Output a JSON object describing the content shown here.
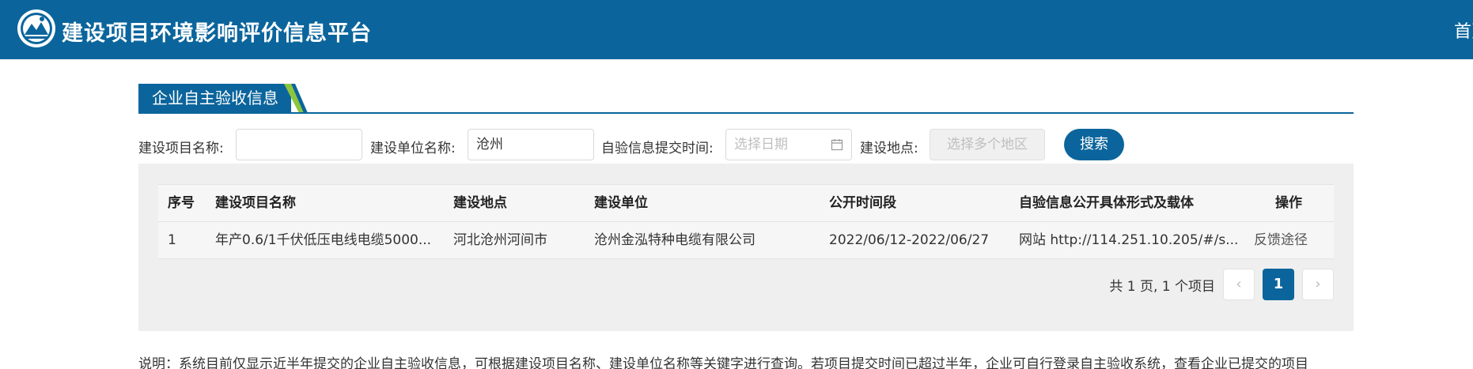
{
  "header": {
    "title": "建设项目环境影响评价信息平台",
    "nav_home": "首页",
    "logo_icon": "ministry-emblem-icon"
  },
  "section": {
    "tab_label": "企业自主验收信息"
  },
  "search": {
    "project_name_label": "建设项目名称:",
    "project_name_value": "",
    "unit_name_label": "建设单位名称:",
    "unit_name_value": "沧州",
    "submit_time_label": "自验信息提交时间:",
    "submit_time_placeholder": "选择日期",
    "location_label": "建设地点:",
    "location_placeholder": "选择多个地区",
    "search_button": "搜索"
  },
  "table": {
    "columns": [
      "序号",
      "建设项目名称",
      "建设地点",
      "建设单位",
      "公开时间段",
      "自验信息公开具体形式及载体",
      "操作"
    ],
    "rows": [
      {
        "index": "1",
        "project": "年产0.6/1千伏低压电线电缆5000...",
        "location": "河北沧州河间市",
        "unit": "沧州金泓特种电缆有限公司",
        "period": "2022/06/12-2022/06/27",
        "carrier": "网站 http://114.251.10.205/#/s...",
        "action": "反馈途径"
      }
    ]
  },
  "pagination": {
    "summary": "共 1 页, 1 个项目",
    "prev": "‹",
    "current": "1",
    "next": "›"
  },
  "note": "说明：系统目前仅显示近半年提交的企业自主验收信息，可根据建设项目名称、建设单位名称等关键字进行查询。若项目提交时间已超过半年，企业可自行登录自主验收系统，查看企业已提交的项目",
  "colors": {
    "brand": "#0b659c",
    "accent_green": "#8cc63f",
    "panel_bg": "#efefef"
  }
}
